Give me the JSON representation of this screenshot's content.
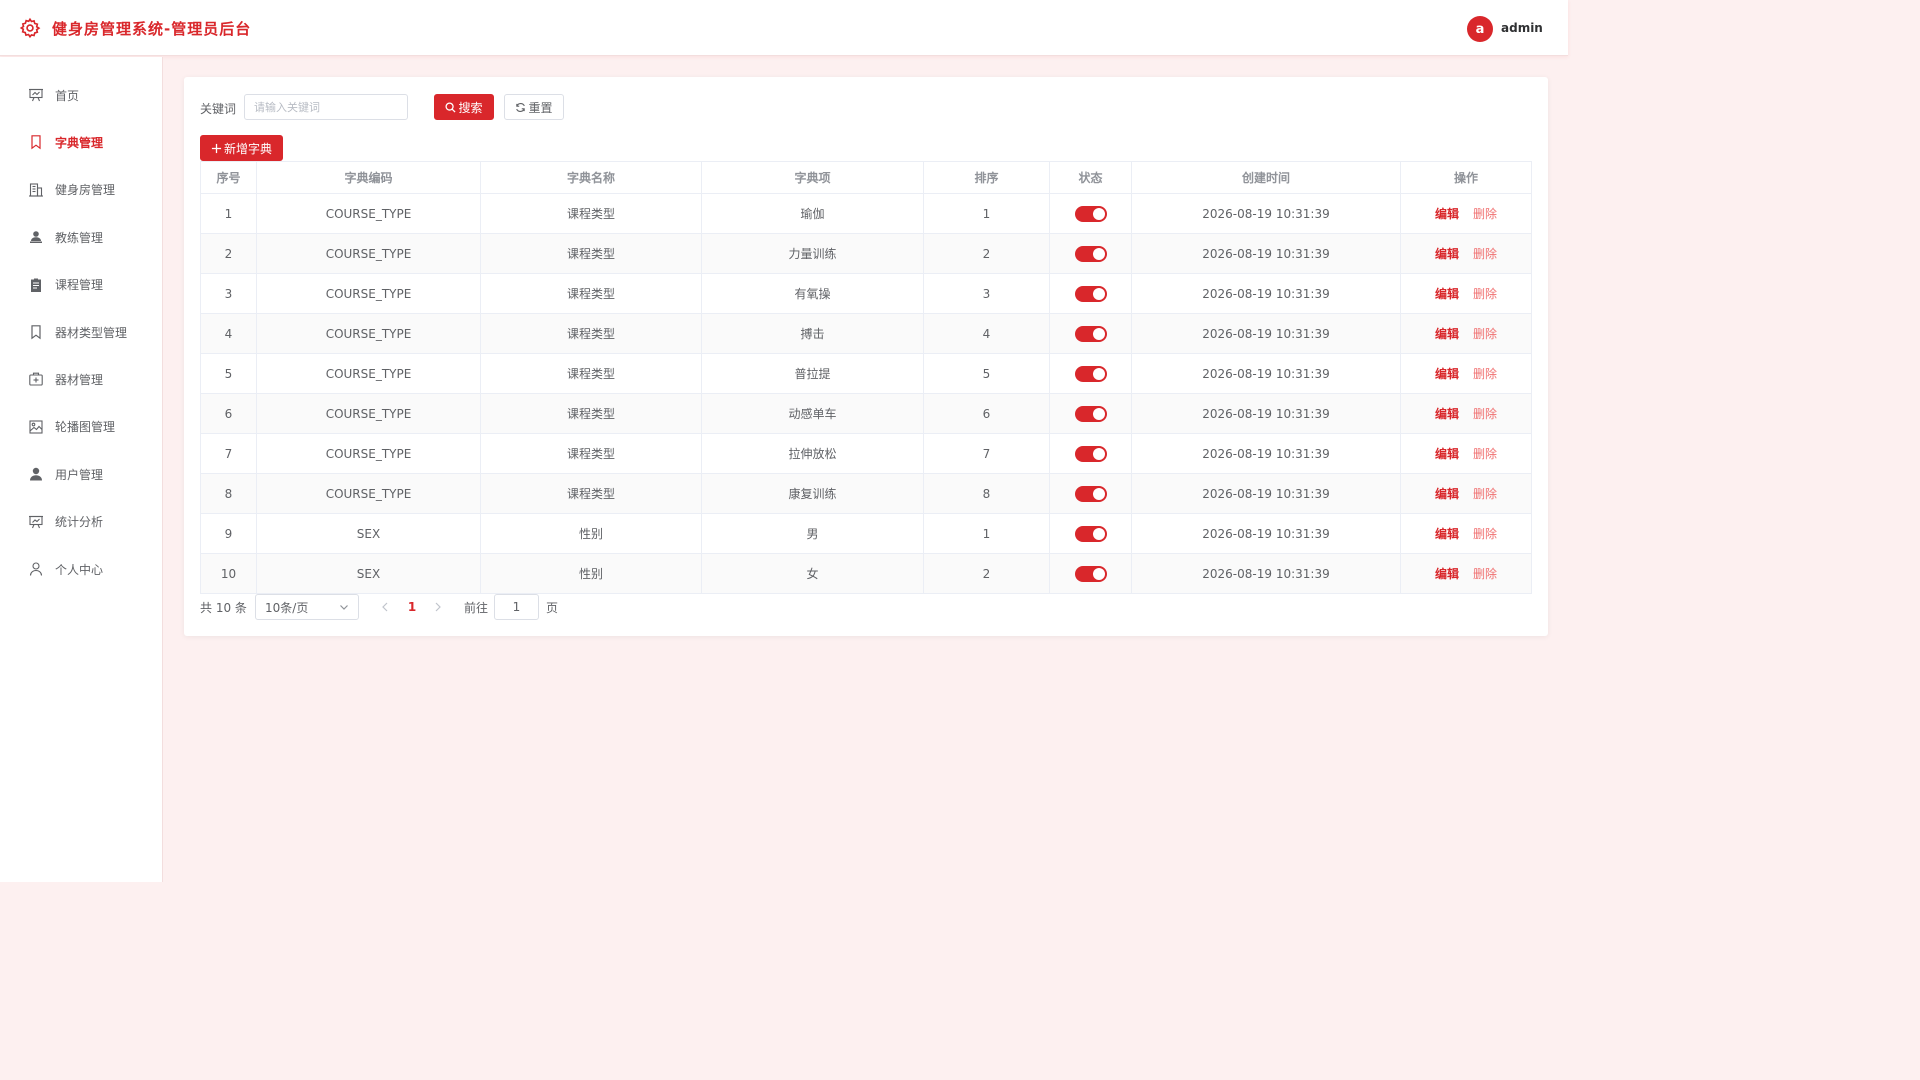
{
  "header": {
    "title": "健身房管理系统-管理员后台",
    "avatar_letter": "a",
    "username": "admin",
    "accent_color": "#d9272b"
  },
  "sidebar": {
    "active_index": 1,
    "items": [
      {
        "label": "首页",
        "icon": "presentation-board-icon"
      },
      {
        "label": "字典管理",
        "icon": "bookmark-icon"
      },
      {
        "label": "健身房管理",
        "icon": "building-icon"
      },
      {
        "label": "教练管理",
        "icon": "person-stand-icon"
      },
      {
        "label": "课程管理",
        "icon": "clipboard-icon"
      },
      {
        "label": "器材类型管理",
        "icon": "bookmark-icon"
      },
      {
        "label": "器材管理",
        "icon": "first-aid-box-icon"
      },
      {
        "label": "轮播图管理",
        "icon": "image-icon"
      },
      {
        "label": "用户管理",
        "icon": "user-filled-icon"
      },
      {
        "label": "统计分析",
        "icon": "chart-board-icon"
      },
      {
        "label": "个人中心",
        "icon": "user-outline-icon"
      }
    ]
  },
  "toolbar": {
    "keyword_label": "关键词",
    "keyword_placeholder": "请输入关键词",
    "keyword_value": "",
    "search_label": "搜索",
    "reset_label": "重置",
    "add_label": "新增字典"
  },
  "table": {
    "columns": [
      "序号",
      "字典编码",
      "字典名称",
      "字典项",
      "排序",
      "状态",
      "创建时间",
      "操作"
    ],
    "edit_label": "编辑",
    "delete_label": "删除",
    "rows": [
      {
        "index": "1",
        "code": "COURSE_TYPE",
        "name": "课程类型",
        "item": "瑜伽",
        "sort": "1",
        "enabled": true,
        "created": "2026-08-19 10:31:39"
      },
      {
        "index": "2",
        "code": "COURSE_TYPE",
        "name": "课程类型",
        "item": "力量训练",
        "sort": "2",
        "enabled": true,
        "created": "2026-08-19 10:31:39"
      },
      {
        "index": "3",
        "code": "COURSE_TYPE",
        "name": "课程类型",
        "item": "有氧操",
        "sort": "3",
        "enabled": true,
        "created": "2026-08-19 10:31:39"
      },
      {
        "index": "4",
        "code": "COURSE_TYPE",
        "name": "课程类型",
        "item": "搏击",
        "sort": "4",
        "enabled": true,
        "created": "2026-08-19 10:31:39"
      },
      {
        "index": "5",
        "code": "COURSE_TYPE",
        "name": "课程类型",
        "item": "普拉提",
        "sort": "5",
        "enabled": true,
        "created": "2026-08-19 10:31:39"
      },
      {
        "index": "6",
        "code": "COURSE_TYPE",
        "name": "课程类型",
        "item": "动感单车",
        "sort": "6",
        "enabled": true,
        "created": "2026-08-19 10:31:39"
      },
      {
        "index": "7",
        "code": "COURSE_TYPE",
        "name": "课程类型",
        "item": "拉伸放松",
        "sort": "7",
        "enabled": true,
        "created": "2026-08-19 10:31:39"
      },
      {
        "index": "8",
        "code": "COURSE_TYPE",
        "name": "课程类型",
        "item": "康复训练",
        "sort": "8",
        "enabled": true,
        "created": "2026-08-19 10:31:39"
      },
      {
        "index": "9",
        "code": "SEX",
        "name": "性别",
        "item": "男",
        "sort": "1",
        "enabled": true,
        "created": "2026-08-19 10:31:39"
      },
      {
        "index": "10",
        "code": "SEX",
        "name": "性别",
        "item": "女",
        "sort": "2",
        "enabled": true,
        "created": "2026-08-19 10:31:39"
      }
    ]
  },
  "pagination": {
    "total_text": "共 10 条",
    "page_size": "10条/页",
    "current_page": "1",
    "goto_label": "前往",
    "goto_value": "1",
    "page_suffix": "页"
  }
}
